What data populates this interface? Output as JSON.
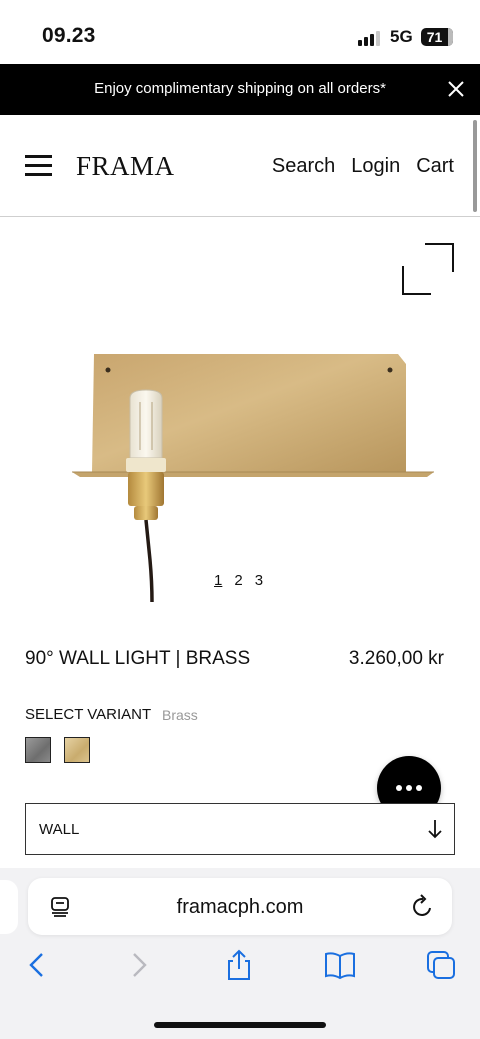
{
  "status_bar": {
    "time": "09.23",
    "network": "5G",
    "battery": "71"
  },
  "promo": {
    "text": "Enjoy complimentary shipping on all orders*"
  },
  "header": {
    "logo": "FRAMA",
    "nav": {
      "search": "Search",
      "login": "Login",
      "cart": "Cart"
    }
  },
  "gallery": {
    "pages": [
      "1",
      "2",
      "3"
    ],
    "active_page": "1"
  },
  "product": {
    "title": "90° WALL LIGHT | BRASS",
    "price": "3.260,00 kr",
    "variant_label": "SELECT VARIANT",
    "selected_variant": "Brass",
    "swatch_colors": {
      "steel": "#8a8a8a",
      "brass": "#d7bf88"
    },
    "mount_select": "WALL"
  },
  "browser": {
    "url": "framacph.com"
  },
  "colors": {
    "banner_bg": "#000000",
    "accent": "#1a6fe0"
  }
}
